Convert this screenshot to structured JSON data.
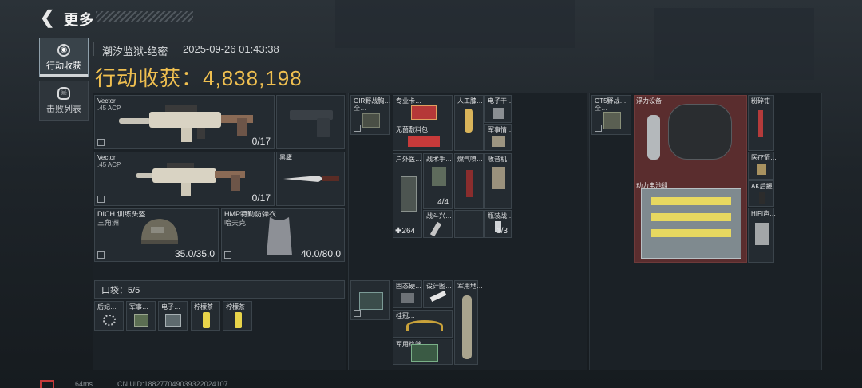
{
  "header": {
    "back_icon": "back-arrow-icon",
    "title": "更多"
  },
  "tabs": [
    {
      "label": "行动收获",
      "icon": "loot-icon",
      "active": true
    },
    {
      "label": "击败列表",
      "icon": "skull-icon",
      "active": false
    }
  ],
  "info": {
    "map": "潮汐监狱-绝密",
    "datetime": "2025-09-26 01:43:38",
    "value_label": "行动收获：",
    "value": "4,838,198"
  },
  "gear": {
    "primary": {
      "name": "Vector",
      "ammo": ".45 ACP",
      "count": "0/17"
    },
    "secondary": {
      "name": "Vector",
      "ammo": ".45 ACP",
      "count": "0/17"
    },
    "melee": {
      "name": "黑鹰"
    },
    "helmet": {
      "name": "DICH 训练头盔",
      "brand": "三角洲",
      "durability": "35.0/35.0"
    },
    "armor": {
      "name": "HMP特勤防弹衣",
      "brand": "哈夫克",
      "durability": "40.0/80.0"
    },
    "pocket": {
      "label": "口袋：5/5",
      "items": [
        "后妃…",
        "军事…",
        "电子…",
        "柠檬茶",
        "柠檬茶"
      ]
    }
  },
  "chest_rig": {
    "item": "GIR野战胸…",
    "subitem": "全…"
  },
  "rig_items": [
    "专业卡…",
    "无菌敷料包",
    "人工膝…",
    "电子干…",
    "军事情…",
    "户外医…",
    "战术手…",
    "燃气喷…",
    "收音机",
    "战斗兴…",
    "瓶装战…"
  ],
  "rig_counts": {
    "med": "264",
    "tactical": "4/4",
    "bottled": "1/3"
  },
  "backpack": {
    "items": [
      "固态硬…",
      "设计图…",
      "军用地…",
      "桂冠…",
      "军用终端"
    ]
  },
  "safe": {
    "item": "GT5野战…",
    "subitem": "全…"
  },
  "bag_items": [
    "浮力设备",
    "粉碎钳",
    "医疗箭…",
    "动力电池组",
    "AK后握",
    "HIFI声…"
  ],
  "footer": {
    "ping": "64ms",
    "uid": "CN UID:1882770490393220241​07"
  },
  "colors": {
    "accent": "#f0c050",
    "highlight": "#5a2d2e"
  }
}
